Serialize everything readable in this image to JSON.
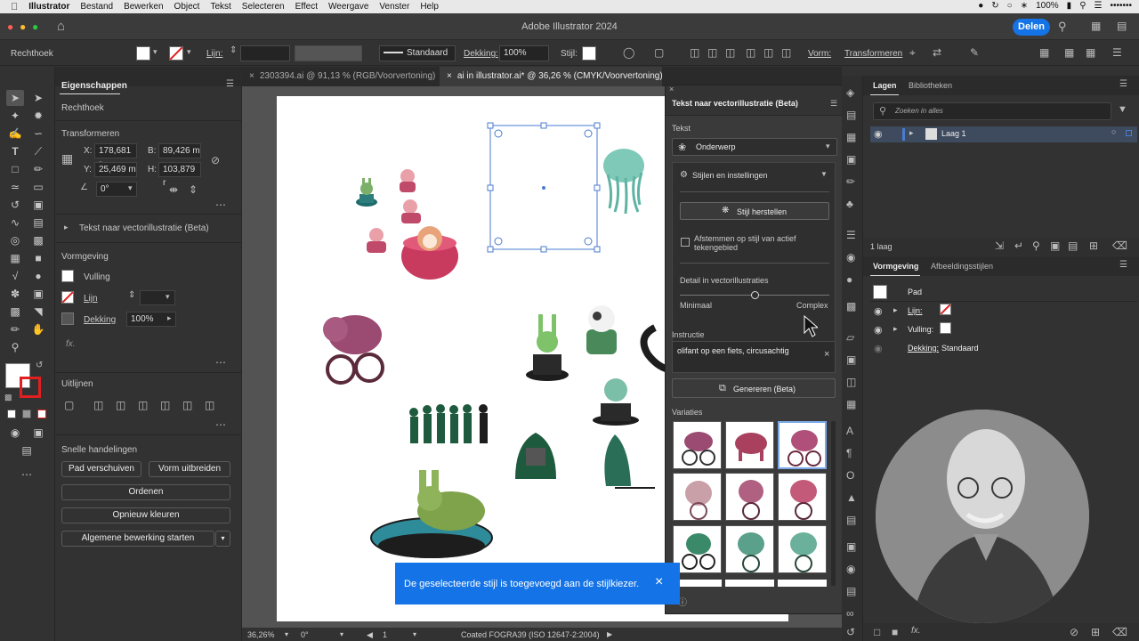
{
  "menubar": {
    "app": "Illustrator",
    "items": [
      "Bestand",
      "Bewerken",
      "Object",
      "Tekst",
      "Selecteren",
      "Effect",
      "Weergave",
      "Venster",
      "Help"
    ],
    "battery": "100%",
    "clock": "•••••••"
  },
  "titlebar": {
    "title": "Adobe Illustrator 2024",
    "share_label": "Delen"
  },
  "control": {
    "object_type": "Rechthoek",
    "stroke_label": "Lijn:",
    "brush_value": "Standaard",
    "opacity_label": "Dekking:",
    "opacity_value": "100%",
    "style_label": "Stijl:",
    "shape_label": "Vorm:",
    "transform_label": "Transformeren"
  },
  "properties": {
    "tab": "Eigenschappen",
    "object": "Rechthoek",
    "transform_title": "Transformeren",
    "x_label": "X:",
    "x": "178,681 r",
    "y_label": "Y:",
    "y": "25,469 m",
    "b_label": "B:",
    "b": "89,426 m",
    "h_label": "H:",
    "h": "103,879 r",
    "angle": "0°",
    "text_to_vector": "Tekst naar vectorillustratie (Beta)",
    "appearance_title": "Vormgeving",
    "fill_label": "Vulling",
    "stroke_label": "Lijn",
    "opacity_label": "Dekking",
    "opacity_value": "100%",
    "fx": "fx.",
    "align_title": "Uitlijnen",
    "quick_title": "Snelle handelingen",
    "btn_offset": "Pad verschuiven",
    "btn_expand": "Vorm uitbreiden",
    "btn_arrange": "Ordenen",
    "btn_recolor": "Opnieuw kleuren",
    "btn_edit": "Algemene bewerking starten"
  },
  "doc_tabs": [
    {
      "label": "2303394.ai @ 91,13 % (RGB/Voorvertoning)",
      "active": false
    },
    {
      "label": "ai in illustrator.ai* @ 36,26 % (CMYK/Voorvertoning)",
      "active": true
    }
  ],
  "text_to_vector": {
    "title": "Tekst naar vectorillustratie (Beta)",
    "text_section": "Tekst",
    "type_value": "Onderwerp",
    "styles_label": "Stijlen en instellingen",
    "reset_style": "Stijl herstellen",
    "match_label": "Afstemmen op stijl van actief tekengebied",
    "detail_label": "Detail in vectorillustraties",
    "detail_min": "Minimaal",
    "detail_max": "Complex",
    "detail_level": 0.5,
    "prompt_label": "Instructie",
    "prompt_value": "olifant op een fiets, circusachtig",
    "generate": "Genereren (Beta)",
    "variations_label": "Variaties"
  },
  "layers": {
    "tab_active": "Lagen",
    "tab_other": "Bibliotheken",
    "search_placeholder": "Zoeken in alles",
    "layer_name": "Laag 1",
    "count": "1 laag"
  },
  "appearance": {
    "tab_active": "Vormgeving",
    "tab_other": "Afbeeldingsstijlen",
    "path": "Pad",
    "stroke": "Lijn:",
    "fill": "Vulling:",
    "opacity_label": "Dekking:",
    "opacity_value": "Standaard"
  },
  "status": {
    "zoom": "36,26%",
    "rotation": "0°",
    "artboard": "1",
    "profile": "Coated FOGRA39 (ISO 12647-2:2004)"
  },
  "toast": {
    "message": "De geselecteerde stijl is toegevoegd aan de stijlkiezer."
  },
  "colors": {
    "accent": "#1473e6",
    "panel": "#323232",
    "selection": "#4a7bd0",
    "teal": "#3aa89a",
    "pink": "#c46a8a"
  }
}
